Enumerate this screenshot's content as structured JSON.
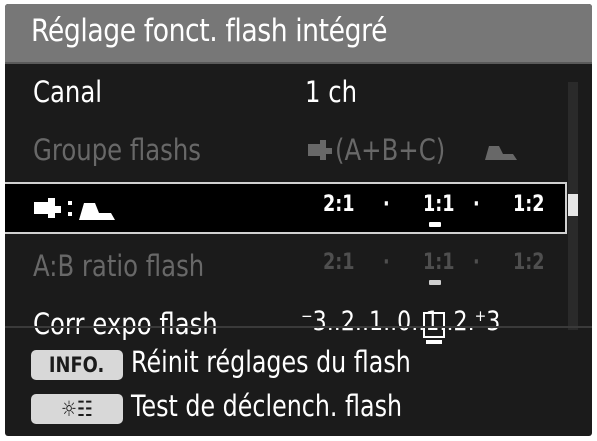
{
  "header": {
    "title": "Réglage fonct. flash intégré"
  },
  "menu": {
    "canal": {
      "label": "Canal",
      "value": "1  ch"
    },
    "groupe": {
      "label": "Groupe flashs",
      "value": "(A+B+C)"
    },
    "ratio_row": {
      "values": [
        "2:1",
        "·",
        "1:1",
        "·",
        "1:2"
      ]
    },
    "ab_ratio": {
      "label": "A:B ratio flash",
      "values": [
        "2:1",
        "·",
        "1:1",
        "·",
        "1:2"
      ]
    },
    "corr_expo": {
      "label": "Corr expo flash",
      "scale": "⁻3..2..1..0..1..2.⁺3",
      "current": "0"
    }
  },
  "footer": {
    "info_button": "INFO.",
    "info_text": "Réinit réglages du flash",
    "test_button": "☼☷",
    "test_text": "Test de déclench. flash"
  },
  "colors": {
    "background": "#1b1b1b",
    "header_bg": "#777777",
    "dim_text": "#686868",
    "highlight_border": "#d0d0d0"
  }
}
